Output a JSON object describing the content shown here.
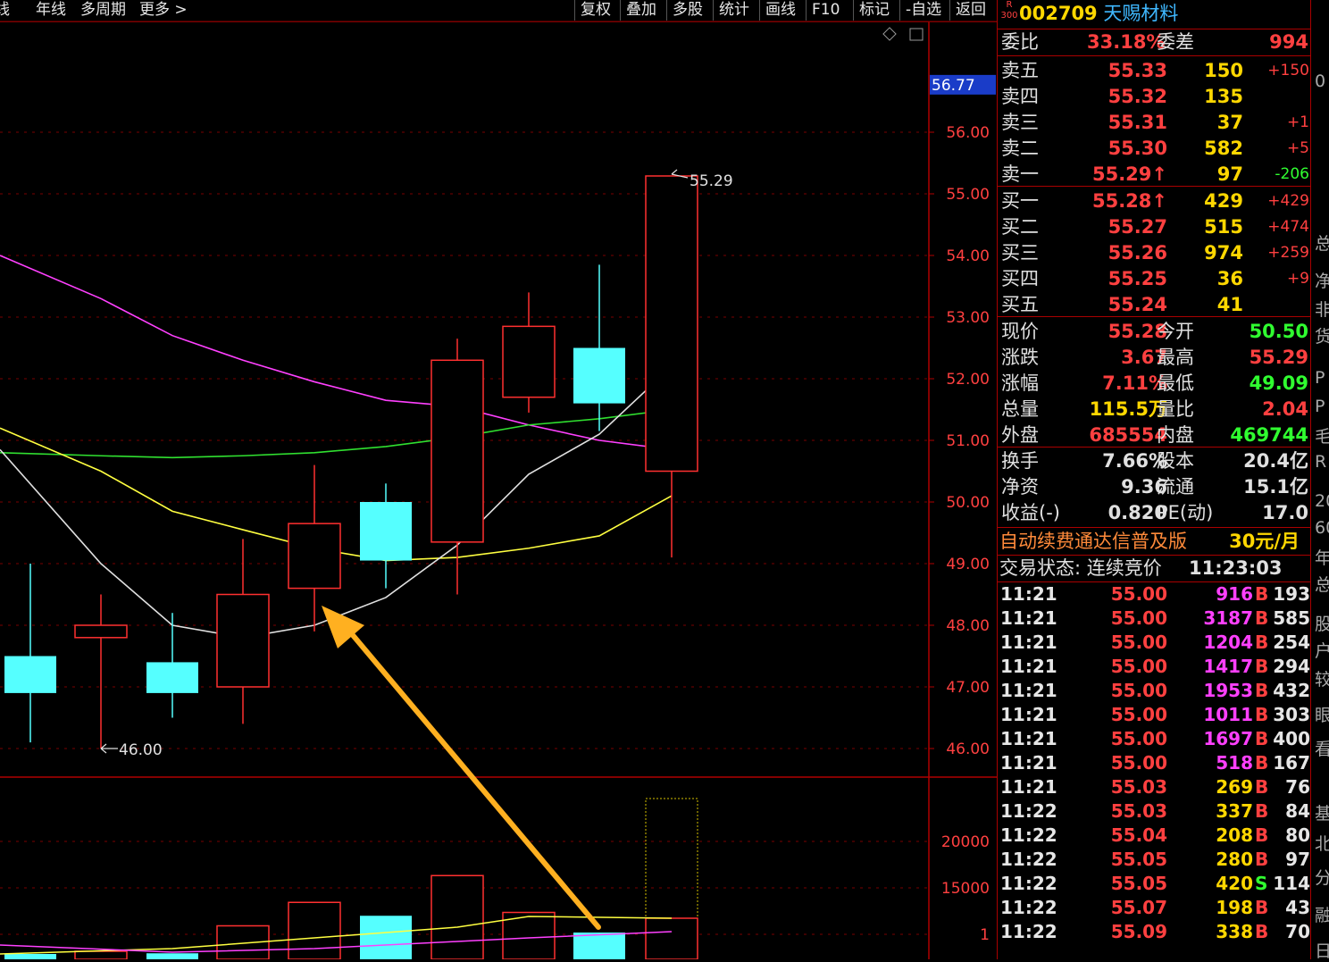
{
  "toolbar": {
    "left_tabs": [
      "线",
      "年线",
      "多周期",
      "更多 >"
    ],
    "buttons": [
      "复权",
      "叠加",
      "多股",
      "统计",
      "画线",
      "F10",
      "标记",
      "-自选",
      "返回"
    ]
  },
  "chart": {
    "price_axis_labels": [
      "56.00",
      "55.00",
      "54.00",
      "53.00",
      "52.00",
      "51.00",
      "50.00",
      "49.00",
      "48.00",
      "47.00",
      "46.00"
    ],
    "current_price_tag": "56.77",
    "high_annotation": "55.29",
    "low_annotation": "46.00",
    "volume_axis_labels": [
      "20000",
      "15000",
      "1"
    ],
    "colors": {
      "up": "#ff3030",
      "down": "#55ffff",
      "ma5": "#e0e0e0",
      "ma10": "#ffff40",
      "ma20": "#ff40ff",
      "ma60": "#30e030",
      "arrow": "#ffb020"
    }
  },
  "chart_data": {
    "type": "candlestick",
    "candles": [
      {
        "open": 47.5,
        "close": 46.9,
        "high": 49.0,
        "low": 46.1,
        "dir": "down"
      },
      {
        "open": 47.8,
        "close": 48.0,
        "high": 48.5,
        "low": 46.0,
        "dir": "up"
      },
      {
        "open": 47.4,
        "close": 46.9,
        "high": 48.2,
        "low": 46.5,
        "dir": "down"
      },
      {
        "open": 47.0,
        "close": 48.5,
        "high": 49.4,
        "low": 46.4,
        "dir": "up"
      },
      {
        "open": 48.6,
        "close": 49.65,
        "high": 50.6,
        "low": 47.9,
        "dir": "up"
      },
      {
        "open": 50.0,
        "close": 49.05,
        "high": 50.3,
        "low": 48.6,
        "dir": "down"
      },
      {
        "open": 49.35,
        "close": 52.3,
        "high": 52.65,
        "low": 48.5,
        "dir": "up"
      },
      {
        "open": 51.7,
        "close": 52.85,
        "high": 53.4,
        "low": 51.45,
        "dir": "up"
      },
      {
        "open": 52.5,
        "close": 51.6,
        "high": 53.85,
        "low": 51.15,
        "dir": "down"
      },
      {
        "open": 50.5,
        "close": 55.29,
        "high": 55.29,
        "low": 49.1,
        "dir": "up"
      }
    ],
    "ma5": [
      50.1,
      49.0,
      48.0,
      47.8,
      48.0,
      48.45,
      49.3,
      50.45,
      51.1,
      52.2
    ],
    "ma10": [
      51.2,
      50.5,
      49.85,
      49.55,
      49.25,
      49.05,
      49.1,
      49.25,
      49.45,
      50.1
    ],
    "ma20": [
      54.0,
      53.3,
      52.7,
      52.3,
      51.95,
      51.65,
      51.55,
      51.25,
      51.0,
      50.85
    ],
    "ma60": [
      50.8,
      50.75,
      50.72,
      50.75,
      50.8,
      50.9,
      51.05,
      51.25,
      51.35,
      51.5
    ],
    "volumes": [
      800,
      1200,
      900,
      5000,
      8500,
      6500,
      12500,
      7000,
      4000,
      24000
    ],
    "y_range": [
      45.5,
      57.0
    ]
  },
  "quote": {
    "market_badge": "R\n300",
    "code": "002709",
    "name": "天赐材料",
    "weibi_label": "委比",
    "weibi": "33.18%",
    "weicha_label": "委差",
    "weicha": "994",
    "asks": [
      {
        "label": "卖五",
        "price": "55.33",
        "vol": "150",
        "chg": "+150"
      },
      {
        "label": "卖四",
        "price": "55.32",
        "vol": "135",
        "chg": ""
      },
      {
        "label": "卖三",
        "price": "55.31",
        "vol": "37",
        "chg": "+1"
      },
      {
        "label": "卖二",
        "price": "55.30",
        "vol": "582",
        "chg": "+5"
      },
      {
        "label": "卖一",
        "price": "55.29↑",
        "vol": "97",
        "chg": "-206"
      }
    ],
    "bids": [
      {
        "label": "买一",
        "price": "55.28↑",
        "vol": "429",
        "chg": "+429"
      },
      {
        "label": "买二",
        "price": "55.27",
        "vol": "515",
        "chg": "+474"
      },
      {
        "label": "买三",
        "price": "55.26",
        "vol": "974",
        "chg": "+259"
      },
      {
        "label": "买四",
        "price": "55.25",
        "vol": "36",
        "chg": "+9"
      },
      {
        "label": "买五",
        "price": "55.24",
        "vol": "41",
        "chg": ""
      }
    ],
    "stats1": [
      {
        "l1": "现价",
        "v1": "55.28",
        "l2": "今开",
        "v2": "50.50",
        "c1": "#ff4040",
        "c2": "#30ff30"
      },
      {
        "l1": "涨跌",
        "v1": "3.67",
        "l2": "最高",
        "v2": "55.29",
        "c1": "#ff4040",
        "c2": "#ff4040"
      },
      {
        "l1": "涨幅",
        "v1": "7.11%",
        "l2": "最低",
        "v2": "49.09",
        "c1": "#ff4040",
        "c2": "#30ff30"
      },
      {
        "l1": "总量",
        "v1": "115.5万",
        "l2": "量比",
        "v2": "2.04",
        "c1": "#ffd700",
        "c2": "#ff4040"
      },
      {
        "l1": "外盘",
        "v1": "685554",
        "l2": "内盘",
        "v2": "469744",
        "c1": "#ff4040",
        "c2": "#30ff30"
      }
    ],
    "stats2": [
      {
        "l1": "换手",
        "v1": "7.66%",
        "l2": "股本",
        "v2": "20.4亿"
      },
      {
        "l1": "净资",
        "v1": "9.36",
        "l2": "流通",
        "v2": "15.1亿"
      },
      {
        "l1": "收益(-)",
        "v1": "0.820",
        "l2": "PE(动)",
        "v2": "17.0"
      }
    ],
    "promo_text": "自动续费通达信普及版",
    "promo_price": "30元/月",
    "trade_status": "交易状态: 连续竞价",
    "trade_time": "11:23:03",
    "ticks": [
      {
        "t": "11:21",
        "p": "55.00",
        "v": "916",
        "bs": "B",
        "n": "193",
        "vc": "#ff40ff"
      },
      {
        "t": "11:21",
        "p": "55.00",
        "v": "3187",
        "bs": "B",
        "n": "585",
        "vc": "#ff40ff"
      },
      {
        "t": "11:21",
        "p": "55.00",
        "v": "1204",
        "bs": "B",
        "n": "254",
        "vc": "#ff40ff"
      },
      {
        "t": "11:21",
        "p": "55.00",
        "v": "1417",
        "bs": "B",
        "n": "294",
        "vc": "#ff40ff"
      },
      {
        "t": "11:21",
        "p": "55.00",
        "v": "1953",
        "bs": "B",
        "n": "432",
        "vc": "#ff40ff"
      },
      {
        "t": "11:21",
        "p": "55.00",
        "v": "1011",
        "bs": "B",
        "n": "303",
        "vc": "#ff40ff"
      },
      {
        "t": "11:21",
        "p": "55.00",
        "v": "1697",
        "bs": "B",
        "n": "400",
        "vc": "#ff40ff"
      },
      {
        "t": "11:21",
        "p": "55.00",
        "v": "518",
        "bs": "B",
        "n": "167",
        "vc": "#ff40ff"
      },
      {
        "t": "11:21",
        "p": "55.03",
        "v": "269",
        "bs": "B",
        "n": "76",
        "vc": "#ffd700"
      },
      {
        "t": "11:22",
        "p": "55.03",
        "v": "337",
        "bs": "B",
        "n": "84",
        "vc": "#ffd700"
      },
      {
        "t": "11:22",
        "p": "55.04",
        "v": "208",
        "bs": "B",
        "n": "80",
        "vc": "#ffd700"
      },
      {
        "t": "11:22",
        "p": "55.05",
        "v": "280",
        "bs": "B",
        "n": "97",
        "vc": "#ffd700"
      },
      {
        "t": "11:22",
        "p": "55.05",
        "v": "420",
        "bs": "S",
        "n": "114",
        "vc": "#ffd700"
      },
      {
        "t": "11:22",
        "p": "55.07",
        "v": "198",
        "bs": "B",
        "n": "43",
        "vc": "#ffd700"
      },
      {
        "t": "11:22",
        "p": "55.09",
        "v": "338",
        "bs": "B",
        "n": "70",
        "vc": "#ffd700"
      }
    ],
    "right_strip": [
      "0",
      "总",
      "净",
      "非",
      "货",
      "P",
      "P",
      "毛",
      "R",
      "20",
      "60",
      "年",
      "总",
      "股",
      "户",
      "较",
      "眼",
      "看",
      "基",
      "北",
      "分",
      "融",
      "日"
    ]
  }
}
